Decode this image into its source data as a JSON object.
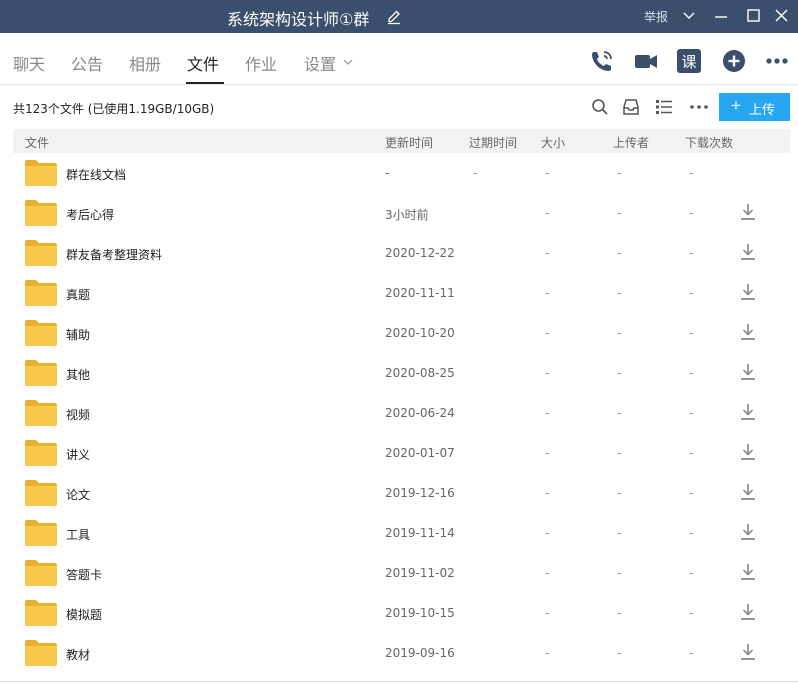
{
  "titlebar": {
    "title": "系统架构设计师①群",
    "report_label": "举报",
    "bg_color": "#3a4f6c",
    "icons": [
      "edit-icon",
      "chevron-down-icon",
      "minimize-icon",
      "maximize-icon",
      "close-icon"
    ]
  },
  "tabs": [
    {
      "label": "聊天",
      "active": false
    },
    {
      "label": "公告",
      "active": false
    },
    {
      "label": "相册",
      "active": false
    },
    {
      "label": "文件",
      "active": true
    },
    {
      "label": "作业",
      "active": false
    },
    {
      "label": "设置",
      "active": false
    }
  ],
  "toolbar_icons": [
    "phone-icon",
    "video-icon",
    "course-icon",
    "add-icon",
    "more-icon"
  ],
  "course_icon_glyph": "课",
  "summary": {
    "text": "共123个文件 (已使用1.19GB/10GB)",
    "upload_label": "上传",
    "upload_color": "#27a7f2",
    "icons": [
      "search-icon",
      "inbox-icon",
      "list-view-icon",
      "more-icon"
    ]
  },
  "columns": {
    "file": "文件",
    "updated": "更新时间",
    "expires": "过期时间",
    "size": "大小",
    "uploader": "上传者",
    "downloads": "下载次数"
  },
  "files": [
    {
      "name": "群在线文档",
      "updated": "-",
      "expires": "-",
      "size": "-",
      "uploader": "-",
      "downloads": "-",
      "downloadable": false
    },
    {
      "name": "考后心得",
      "updated": "3小时前",
      "expires": "",
      "size": "-",
      "uploader": "-",
      "downloads": "-",
      "downloadable": true
    },
    {
      "name": "群友备考整理资料",
      "updated": "2020-12-22",
      "expires": "",
      "size": "-",
      "uploader": "-",
      "downloads": "-",
      "downloadable": true
    },
    {
      "name": "真题",
      "updated": "2020-11-11",
      "expires": "",
      "size": "-",
      "uploader": "-",
      "downloads": "-",
      "downloadable": true
    },
    {
      "name": "辅助",
      "updated": "2020-10-20",
      "expires": "",
      "size": "-",
      "uploader": "-",
      "downloads": "-",
      "downloadable": true
    },
    {
      "name": "其他",
      "updated": "2020-08-25",
      "expires": "",
      "size": "-",
      "uploader": "-",
      "downloads": "-",
      "downloadable": true
    },
    {
      "name": "视频",
      "updated": "2020-06-24",
      "expires": "",
      "size": "-",
      "uploader": "-",
      "downloads": "-",
      "downloadable": true
    },
    {
      "name": "讲义",
      "updated": "2020-01-07",
      "expires": "",
      "size": "-",
      "uploader": "-",
      "downloads": "-",
      "downloadable": true
    },
    {
      "name": "论文",
      "updated": "2019-12-16",
      "expires": "",
      "size": "-",
      "uploader": "-",
      "downloads": "-",
      "downloadable": true
    },
    {
      "name": "工具",
      "updated": "2019-11-14",
      "expires": "",
      "size": "-",
      "uploader": "-",
      "downloads": "-",
      "downloadable": true
    },
    {
      "name": "答题卡",
      "updated": "2019-11-02",
      "expires": "",
      "size": "-",
      "uploader": "-",
      "downloads": "-",
      "downloadable": true
    },
    {
      "name": "模拟题",
      "updated": "2019-10-15",
      "expires": "",
      "size": "-",
      "uploader": "-",
      "downloads": "-",
      "downloadable": true
    },
    {
      "name": "教材",
      "updated": "2019-09-16",
      "expires": "",
      "size": "-",
      "uploader": "-",
      "downloads": "-",
      "downloadable": true
    }
  ],
  "folder_color": "#f9c84a"
}
